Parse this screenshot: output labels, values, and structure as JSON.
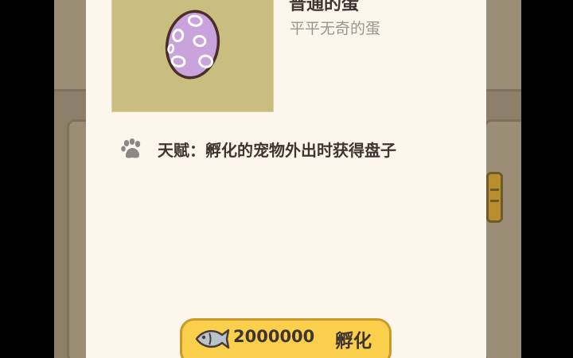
{
  "egg": {
    "name": "普通的蛋",
    "description": "平平无奇的蛋",
    "icon": "spotted-egg-icon",
    "colors": {
      "frame_bg": "#c9bd7f",
      "egg_fill": "#c9a3dc",
      "egg_outline": "#4a2d2b"
    }
  },
  "talent": {
    "icon": "paw-icon",
    "text": "天赋：孵化的宠物外出时获得盘子"
  },
  "hatch_button": {
    "currency_icon": "fish-icon",
    "price": "2000000",
    "label": "孵化",
    "color": "#f9cf4c"
  },
  "theme": {
    "card_bg": "#fdf6ec",
    "text_color": "#3f3431",
    "muted_text": "#9a938e"
  }
}
